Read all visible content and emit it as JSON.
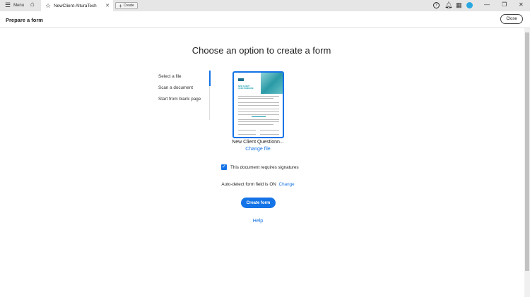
{
  "titlebar": {
    "menu_label": "Menu",
    "tab_title": "NewClient-AlturaTech",
    "create_label": "Create"
  },
  "header": {
    "title": "Prepare a form",
    "close_label": "Close"
  },
  "main": {
    "heading": "Choose an option to create a form",
    "options": [
      {
        "label": "Select a file",
        "active": true
      },
      {
        "label": "Scan a document"
      },
      {
        "label": "Start from blank page"
      }
    ],
    "file": {
      "name": "New Client Questionn...",
      "change_label": "Change file",
      "thumb_title": "NEW CLIENT QUESTIONNAIRE"
    },
    "signatures": {
      "label": "This document requires signatures",
      "checked": true
    },
    "autodetect": {
      "label": "Auto-detect form field is ON",
      "change_label": "Change"
    },
    "create_button": "Create form",
    "help_label": "Help"
  },
  "colors": {
    "accent": "#1473e6"
  }
}
